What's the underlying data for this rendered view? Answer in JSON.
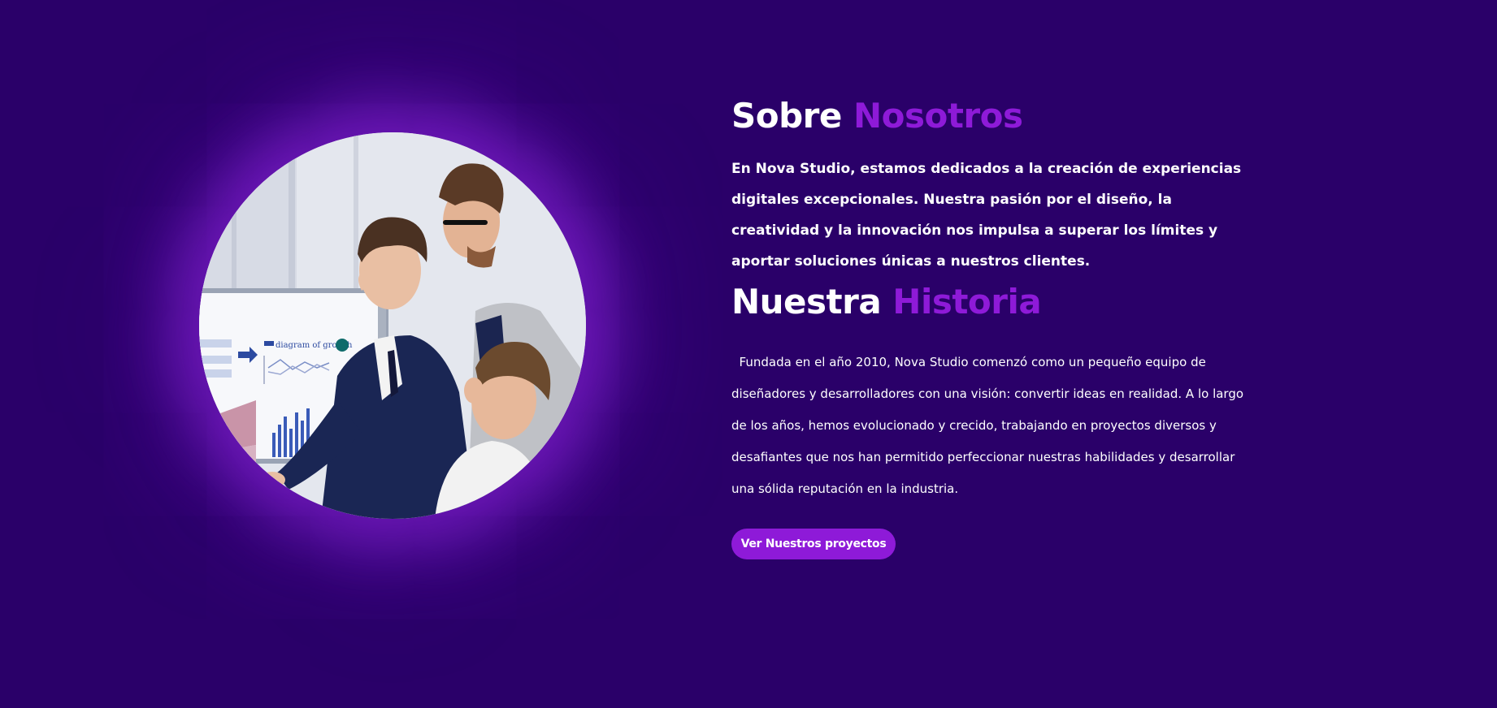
{
  "about": {
    "heading_plain": "Sobre",
    "heading_accent": "Nosotros",
    "lead": "En Nova Studio, estamos dedicados a la creación de experiencias digitales excepcionales. Nuestra pasión por el diseño, la creatividad y la innovación nos impulsa a superar los límites y aportar soluciones únicas a nuestros clientes."
  },
  "history": {
    "heading_plain": "Nuestra",
    "heading_accent": "Historia",
    "body": "  Fundada en el año 2010, Nova Studio comenzó como un pequeño equipo de diseñadores y desarrolladores con una visión: convertir ideas en realidad. A lo largo de los años, hemos evolucionado y crecido, trabajando en proyectos diversos y desafiantes que nos han permitido perfeccionar nuestras habilidades y desarrollar una sólida reputación en la industria."
  },
  "cta": {
    "label": "Ver Nuestros proyectos"
  },
  "photo": {
    "board_title": "diagram of growth"
  },
  "colors": {
    "background": "#2a0069",
    "accent": "#8e1ad8",
    "text": "#ffffff"
  }
}
